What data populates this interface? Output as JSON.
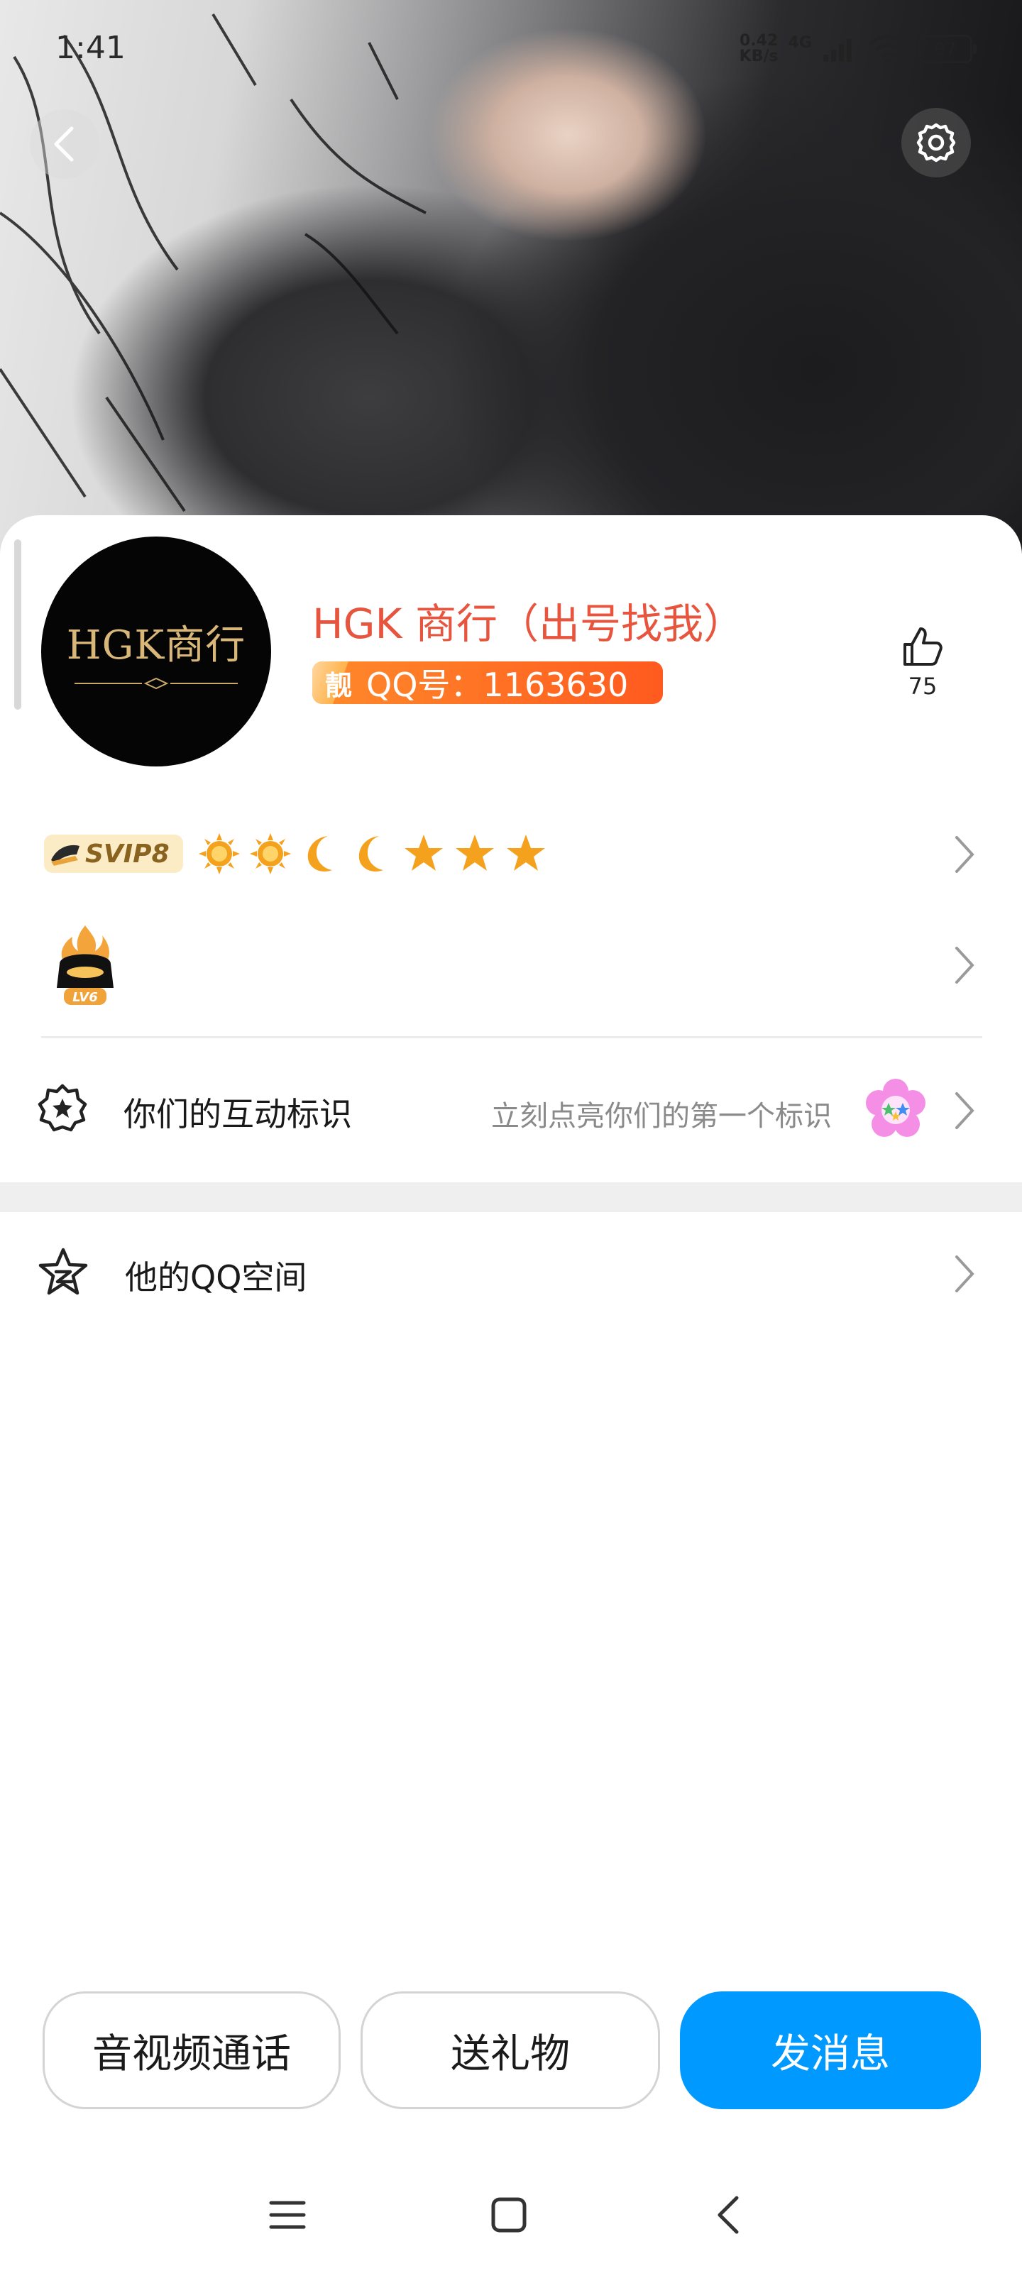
{
  "status_bar": {
    "time": "1:41",
    "net_speed_value": "0.42",
    "net_speed_unit": "KB/s",
    "network_type": "4G",
    "battery": "97"
  },
  "profile": {
    "avatar_text": "HGK商行",
    "nickname": "HGK 商行（出号找我）",
    "pretty_tag": "靓",
    "qq_number": "QQ号：1163630",
    "likes": "75"
  },
  "vip": {
    "svip_label": "SVIP8",
    "level_icons": [
      "sun-icon",
      "sun-icon",
      "moon-icon",
      "moon-icon",
      "star-icon",
      "star-icon",
      "star-icon"
    ]
  },
  "game_level": {
    "badge": "LV6"
  },
  "interaction": {
    "label": "你们的互动标识",
    "hint": "立刻点亮你们的第一个标识"
  },
  "qzone": {
    "label": "他的QQ空间"
  },
  "actions": {
    "call": "音视频通话",
    "gift": "送礼物",
    "message": "发消息"
  },
  "colors": {
    "accent_blue": "#0099ff",
    "nickname_red": "#e8553e",
    "badge_orange": "#ff6a24"
  }
}
